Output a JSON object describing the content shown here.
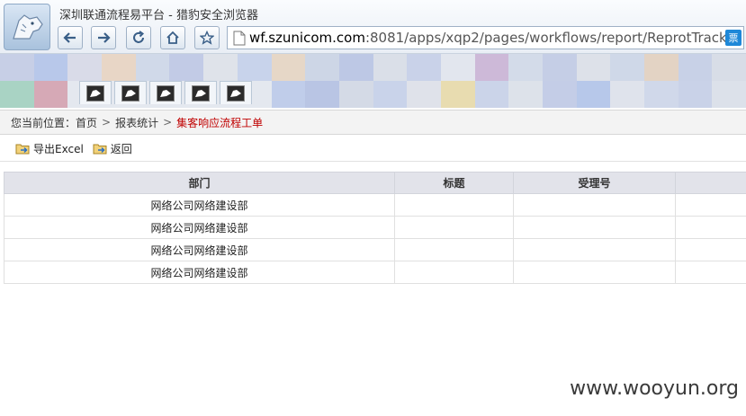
{
  "window": {
    "title": "深圳联通流程易平台 - 猎豹安全浏览器"
  },
  "address_bar": {
    "host": "wf.szunicom.com",
    "rest": ":8081/apps/xqp2/pages/workflows/report/ReprotTrack",
    "badge": "票"
  },
  "breadcrumb": {
    "prefix": "您当前位置：",
    "items": [
      "首页",
      "报表统计"
    ],
    "current": "集客响应流程工单",
    "separator": ">"
  },
  "toolbar": {
    "export_label": "导出Excel",
    "back_label": "返回"
  },
  "table": {
    "columns": [
      "部门",
      "标题",
      "受理号",
      ""
    ],
    "rows": [
      [
        "网络公司网络建设部",
        "",
        "",
        ""
      ],
      [
        "网络公司网络建设部",
        "",
        "",
        ""
      ],
      [
        "网络公司网络建设部",
        "",
        "",
        ""
      ],
      [
        "网络公司网络建设部",
        "",
        "",
        ""
      ]
    ]
  },
  "watermark": "www.wooyun.org",
  "colors": {
    "current_crumb": "#c00000",
    "header_bg": "#e2e3ea",
    "badge": "#1e88d8"
  }
}
